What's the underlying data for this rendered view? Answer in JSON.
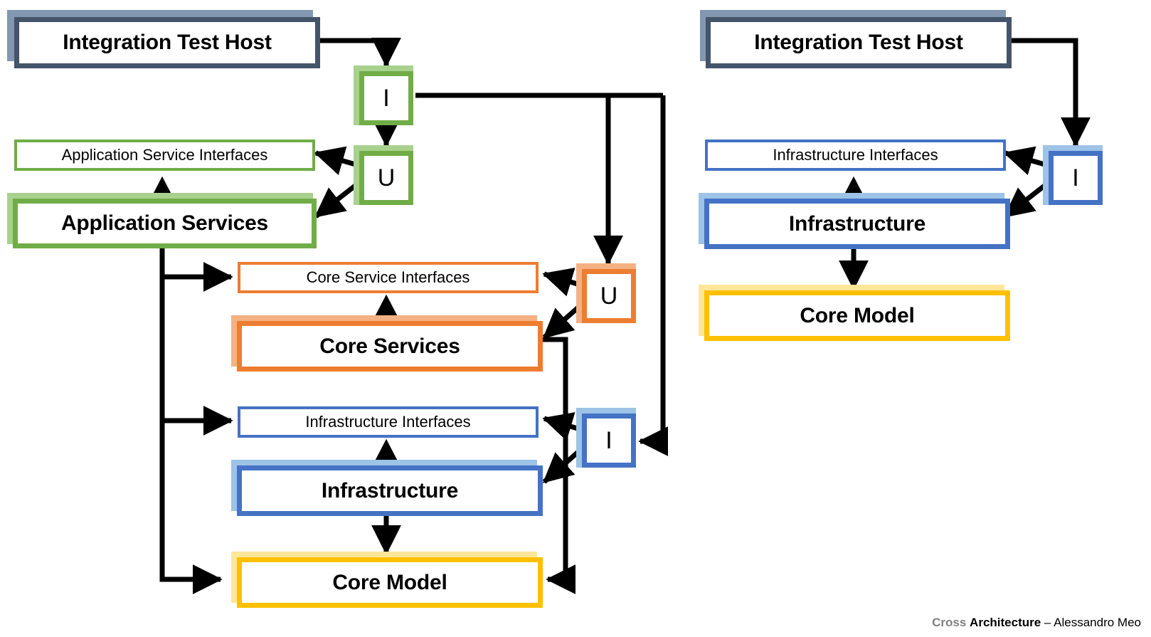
{
  "diagram": {
    "title": "Cross Architecture layered test-host diagram",
    "colors": {
      "host_border": "#44546A",
      "host_shadow": "#8497B0",
      "application_border": "#70AD47",
      "application_shadow": "#A9D18E",
      "core_services_border": "#ED7D31",
      "core_services_shadow": "#F4B183",
      "infrastructure_border": "#4472C4",
      "infrastructure_shadow": "#9DC3E6",
      "core_model_border": "#FFC000",
      "core_model_shadow": "#FFE699",
      "connector": "#000000",
      "background": "#FFFFFF"
    },
    "left_panel": {
      "name": "full-layered-architecture",
      "nodes": {
        "host": {
          "label": "Integration Test Host",
          "kind": "component"
        },
        "badge_i_app": {
          "label": "I",
          "kind": "badge"
        },
        "badge_u_app": {
          "label": "U",
          "kind": "badge"
        },
        "app_interfaces": {
          "label": "Application Service Interfaces",
          "kind": "interface"
        },
        "app_services": {
          "label": "Application Services",
          "kind": "component"
        },
        "core_interfaces": {
          "label": "Core Service Interfaces",
          "kind": "interface"
        },
        "core_services": {
          "label": "Core Services",
          "kind": "component"
        },
        "badge_u_core": {
          "label": "U",
          "kind": "badge"
        },
        "infra_interfaces": {
          "label": "Infrastructure Interfaces",
          "kind": "interface"
        },
        "infrastructure": {
          "label": "Infrastructure",
          "kind": "component"
        },
        "badge_i_infra": {
          "label": "I",
          "kind": "badge"
        },
        "core_model": {
          "label": "Core Model",
          "kind": "component"
        }
      }
    },
    "right_panel": {
      "name": "infrastructure-only-architecture",
      "nodes": {
        "host": {
          "label": "Integration Test Host",
          "kind": "component"
        },
        "badge_i": {
          "label": "I",
          "kind": "badge"
        },
        "infra_interfaces": {
          "label": "Infrastructure Interfaces",
          "kind": "interface"
        },
        "infrastructure": {
          "label": "Infrastructure",
          "kind": "component"
        },
        "core_model": {
          "label": "Core Model",
          "kind": "component"
        }
      }
    }
  },
  "credit": {
    "cross": "Cross",
    "architecture": "Architecture",
    "separator": " – ",
    "author": "Alessandro Meo"
  }
}
